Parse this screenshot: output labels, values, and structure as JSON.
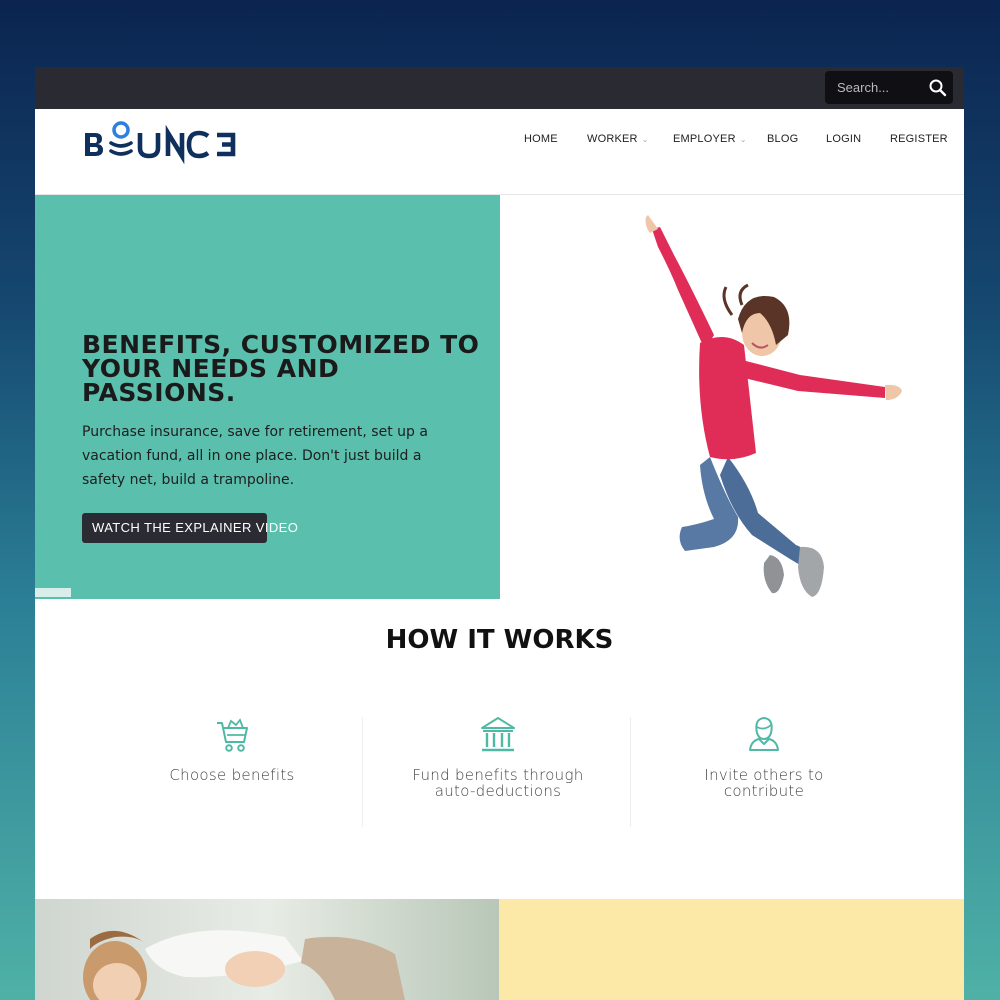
{
  "search": {
    "placeholder": "Search..."
  },
  "brand": {
    "name": "BOUNCE"
  },
  "nav": [
    {
      "label": "HOME",
      "dropdown": false
    },
    {
      "label": "WORKER",
      "dropdown": true
    },
    {
      "label": "EMPLOYER",
      "dropdown": true
    },
    {
      "label": "BLOG",
      "dropdown": false
    },
    {
      "label": "LOGIN",
      "dropdown": false
    },
    {
      "label": "REGISTER",
      "dropdown": false
    }
  ],
  "hero": {
    "title": "BENEFITS, CUSTOMIZED TO YOUR NEEDS AND PASSIONS.",
    "text": "Purchase insurance, save for retirement, set up a vacation fund, all in one place. Don't just build a safety net, build a trampoline.",
    "button": "WATCH THE EXPLAINER VIDEO"
  },
  "how": {
    "title": "HOW IT WORKS",
    "steps": [
      {
        "icon": "shopping-cart-icon",
        "label": "Choose benefits"
      },
      {
        "icon": "bank-building-icon",
        "label": "Fund benefits through auto-deductions"
      },
      {
        "icon": "person-icon",
        "label": "Invite others to contribute"
      }
    ]
  },
  "colors": {
    "accent": "#5bbfad",
    "dark": "#2a2a33",
    "yellow": "#fde9a7",
    "brand": "#0f2f5c"
  }
}
